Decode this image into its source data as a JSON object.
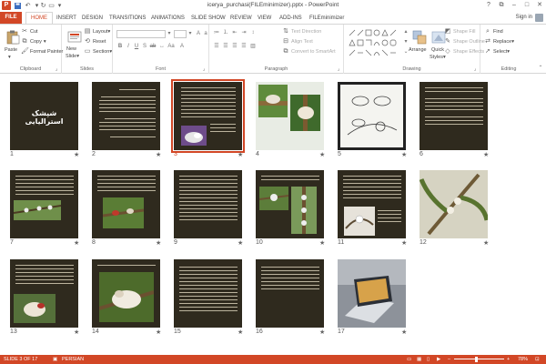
{
  "titlebar": {
    "title": "icerya_purchasi(FILEminimizer).pptx - PowerPoint",
    "app_icon": "P",
    "save_icon": "floppy-disk-icon",
    "undo_icon": "undo-icon",
    "redo_icon": "redo-icon"
  },
  "tabs": [
    "FILE",
    "HOME",
    "INSERT",
    "DESIGN",
    "TRANSITIONS",
    "ANIMATIONS",
    "SLIDE SHOW",
    "REVIEW",
    "VIEW",
    "ADD-INS",
    "FILEminimizer"
  ],
  "signin": "Sign in",
  "ribbon": {
    "clipboard": {
      "label": "Clipboard",
      "paste": "Paste",
      "cut": "Cut",
      "copy": "Copy",
      "format_painter": "Format Painter"
    },
    "slides": {
      "label": "Slides",
      "new_slide": "New",
      "new_slide_2": "Slide",
      "layout": "Layout",
      "reset": "Reset",
      "section": "Section"
    },
    "font": {
      "label": "Font"
    },
    "paragraph": {
      "label": "Paragraph",
      "text_direction": "Text Direction",
      "align_text": "Align Text",
      "convert": "Convert to SmartArt"
    },
    "drawing": {
      "label": "Drawing",
      "arrange": "Arrange",
      "quick_styles": "Quick",
      "quick_styles_2": "Styles",
      "shape_fill": "Shape Fill",
      "shape_outline": "Shape Outline",
      "shape_effects": "Shape Effects"
    },
    "editing": {
      "label": "Editing",
      "find": "Find",
      "replace": "Replace",
      "select": "Select"
    }
  },
  "slides": [
    {
      "num": "1",
      "title": "شپشک استرالیایی"
    },
    {
      "num": "2"
    },
    {
      "num": "3"
    },
    {
      "num": "4"
    },
    {
      "num": "5"
    },
    {
      "num": "6"
    },
    {
      "num": "7"
    },
    {
      "num": "8"
    },
    {
      "num": "9"
    },
    {
      "num": "10"
    },
    {
      "num": "11"
    },
    {
      "num": "12"
    },
    {
      "num": "13"
    },
    {
      "num": "14"
    },
    {
      "num": "15"
    },
    {
      "num": "16"
    },
    {
      "num": "17"
    }
  ],
  "selected_slide": "3",
  "status": {
    "slide_info": "SLIDE 3 OF 17",
    "language": "PERSIAN",
    "zoom": "78%",
    "zoom_fraction": 0.45
  },
  "colors": {
    "accent": "#d24726",
    "slide_bg": "#2f2a1e",
    "selection": "#d24726"
  }
}
